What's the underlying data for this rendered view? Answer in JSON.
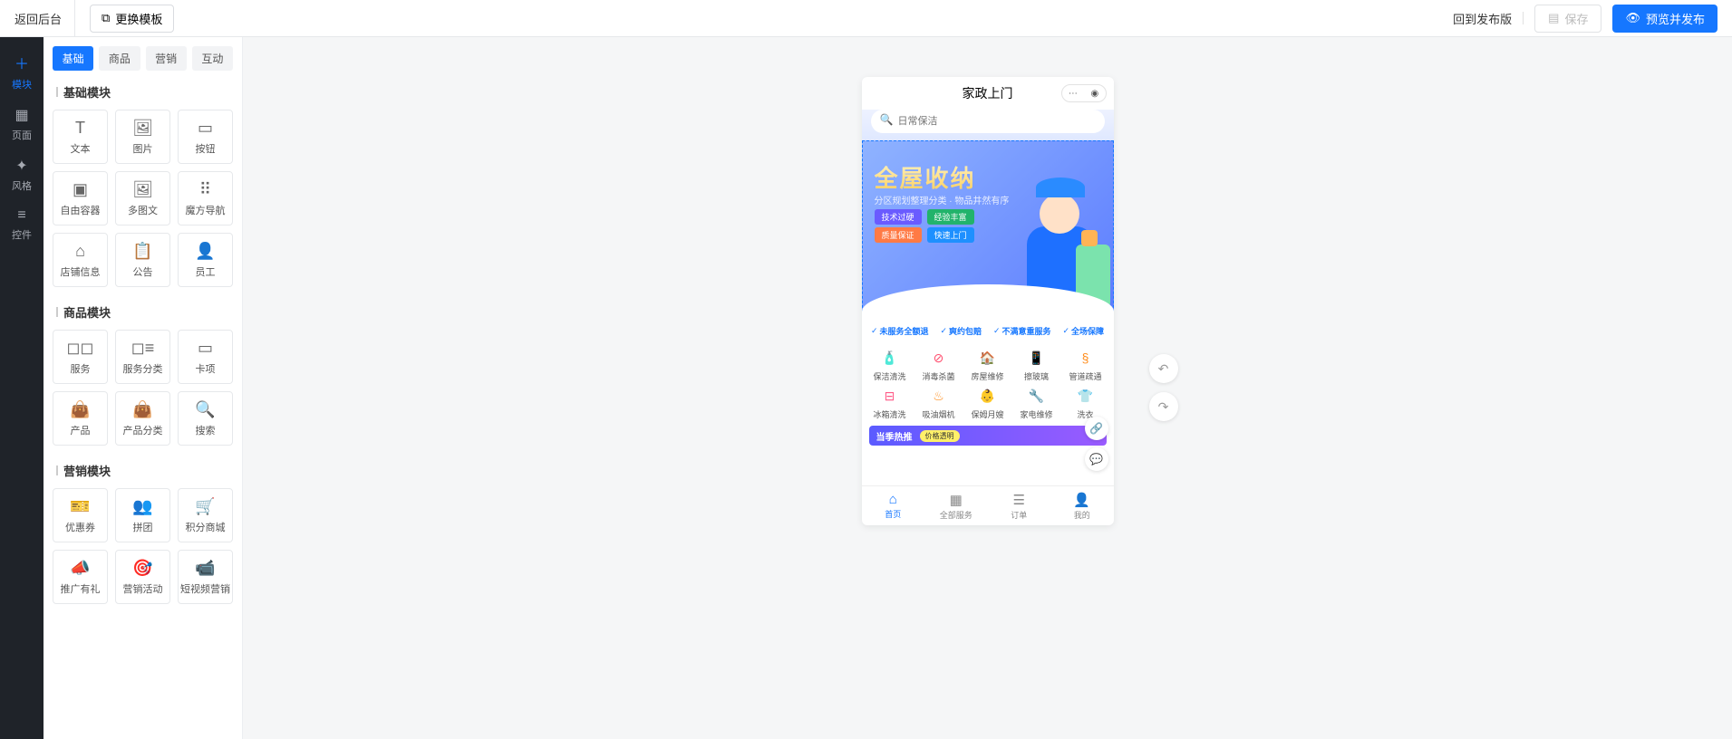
{
  "header": {
    "back": "返回后台",
    "change_template": "更换模板",
    "release_link": "回到发布版",
    "save": "保存",
    "publish": "预览并发布"
  },
  "rail": [
    {
      "icon": "＋",
      "label": "模块"
    },
    {
      "icon": "▦",
      "label": "页面"
    },
    {
      "icon": "✦",
      "label": "风格"
    },
    {
      "icon": "≡",
      "label": "控件"
    }
  ],
  "tabs": [
    "基础",
    "商品",
    "营销",
    "互动"
  ],
  "sections": {
    "basic": {
      "title": "基础模块",
      "items": [
        {
          "icon": "T",
          "label": "文本"
        },
        {
          "icon": "🖼",
          "label": "图片"
        },
        {
          "icon": "▭",
          "label": "按钮"
        },
        {
          "icon": "▣",
          "label": "自由容器"
        },
        {
          "icon": "🖼",
          "label": "多图文"
        },
        {
          "icon": "⠿",
          "label": "魔方导航"
        },
        {
          "icon": "⌂",
          "label": "店铺信息"
        },
        {
          "icon": "📋",
          "label": "公告"
        },
        {
          "icon": "👤",
          "label": "员工"
        }
      ]
    },
    "goods": {
      "title": "商品模块",
      "items": [
        {
          "icon": "◻◻",
          "label": "服务"
        },
        {
          "icon": "◻≡",
          "label": "服务分类"
        },
        {
          "icon": "▭",
          "label": "卡项"
        },
        {
          "icon": "👜",
          "label": "产品"
        },
        {
          "icon": "👜",
          "label": "产品分类"
        },
        {
          "icon": "🔍",
          "label": "搜索"
        }
      ]
    },
    "marketing": {
      "title": "营销模块",
      "items": [
        {
          "icon": "🎫",
          "label": "优惠券"
        },
        {
          "icon": "👥",
          "label": "拼团"
        },
        {
          "icon": "🛒",
          "label": "积分商城"
        },
        {
          "icon": "📣",
          "label": "推广有礼"
        },
        {
          "icon": "🎯",
          "label": "营销活动"
        },
        {
          "icon": "📹",
          "label": "短视频营销"
        }
      ]
    }
  },
  "preview": {
    "title": "家政上门",
    "search_placeholder": "日常保洁",
    "banner": {
      "title": "全屋收纳",
      "subtitle": "分区规划整理分类 · 物品井然有序",
      "tags1": [
        "技术过硬",
        "经验丰富"
      ],
      "tags2": [
        "质量保证",
        "快速上门"
      ]
    },
    "guarantees": [
      "未服务全额退",
      "爽约包赔",
      "不满意重服务",
      "全场保障"
    ],
    "services": [
      {
        "label": "保洁清洗"
      },
      {
        "label": "消毒杀菌"
      },
      {
        "label": "房屋维修"
      },
      {
        "label": "擦玻璃"
      },
      {
        "label": "管道疏通"
      },
      {
        "label": "冰箱清洗"
      },
      {
        "label": "吸油烟机"
      },
      {
        "label": "保姆月嫂"
      },
      {
        "label": "家电维修"
      },
      {
        "label": "洗衣"
      }
    ],
    "svc_icons": [
      "🧴",
      "⊘",
      "🏠",
      "📱",
      "§",
      "⊟",
      "♨",
      "👶",
      "🔧",
      "👕"
    ],
    "promo": {
      "title": "当季热推",
      "chip": "价格透明"
    },
    "tabs": [
      {
        "icon": "⌂",
        "label": "首页"
      },
      {
        "icon": "▦",
        "label": "全部服务"
      },
      {
        "icon": "☰",
        "label": "订单"
      },
      {
        "icon": "👤",
        "label": "我的"
      }
    ]
  }
}
